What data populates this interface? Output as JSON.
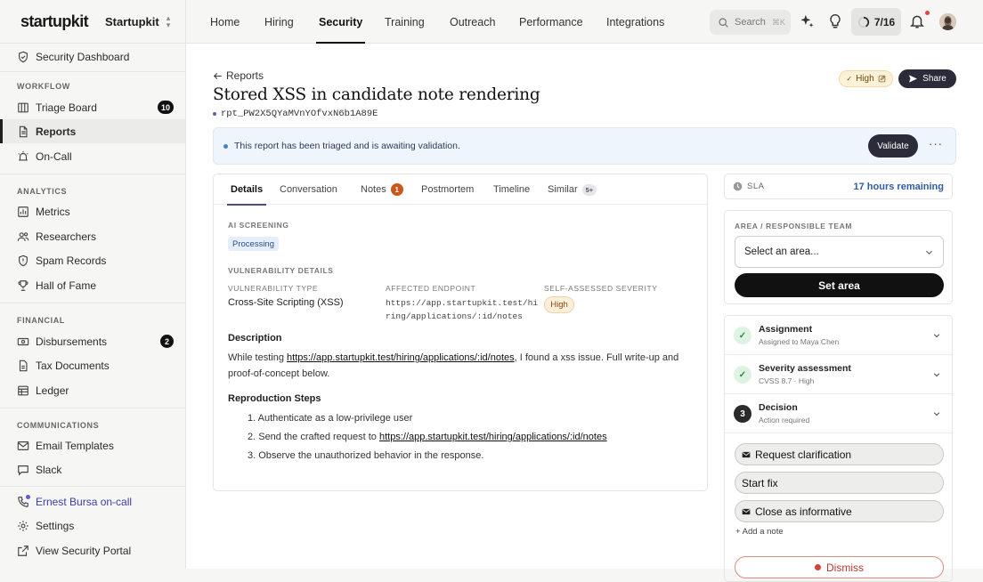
{
  "brand": {
    "logo": "startupkit",
    "org": "Startupkit"
  },
  "sidebar": {
    "top_item": "Security Dashboard",
    "sections": {
      "workflow": "WORKFLOW",
      "analytics": "ANALYTICS",
      "financial": "FINANCIAL",
      "communications": "COMMUNICATIONS"
    },
    "items": {
      "triage": {
        "label": "Triage Board",
        "badge": "10"
      },
      "reports": {
        "label": "Reports"
      },
      "oncall": {
        "label": "On-Call"
      },
      "metrics": {
        "label": "Metrics"
      },
      "researchers": {
        "label": "Researchers"
      },
      "spam": {
        "label": "Spam Records"
      },
      "hall": {
        "label": "Hall of Fame"
      },
      "disbursements": {
        "label": "Disbursements",
        "badge": "2"
      },
      "tax": {
        "label": "Tax Documents"
      },
      "ledger": {
        "label": "Ledger"
      },
      "email": {
        "label": "Email Templates"
      },
      "slack": {
        "label": "Slack"
      }
    },
    "footer": {
      "oncall_user": "Ernest Bursa on-call",
      "settings": "Settings",
      "portal": "View Security Portal"
    }
  },
  "topnav": {
    "tabs": [
      "Home",
      "Hiring",
      "Security",
      "Training",
      "Outreach",
      "Performance",
      "Integrations"
    ],
    "active_tab": "Security",
    "search_placeholder": "Search",
    "search_shortcut": "⌘K",
    "progress": "7/16"
  },
  "report": {
    "back_label": "Reports",
    "title": "Stored XSS in candidate note rendering",
    "id": "rpt_PW2X5QYaMVnYOfvxN6b1A89E",
    "severity_pill": "High",
    "share_label": "Share",
    "banner": "This report has been triaged and is awaiting validation.",
    "validate_label": "Validate"
  },
  "detail_tabs": {
    "details": "Details",
    "conversation": "Conversation",
    "notes": "Notes",
    "notes_count": "1",
    "postmortem": "Postmortem",
    "timeline": "Timeline",
    "similar": "Similar",
    "similar_count": "5+"
  },
  "details": {
    "ai_label": "AI SCREENING",
    "ai_status": "Processing",
    "vuln_label": "VULNERABILITY DETAILS",
    "type_label": "VULNERABILITY TYPE",
    "type_value": "Cross-Site Scripting (XSS)",
    "endpoint_label": "AFFECTED ENDPOINT",
    "endpoint_line1": "https://app.startupkit.test/hi",
    "endpoint_line2": "ring/applications/:id/notes",
    "severity_label": "SELF-ASSESSED SEVERITY",
    "severity_value": "High",
    "desc_heading": "Description",
    "desc_pre": "While testing ",
    "desc_link": "https://app.startupkit.test/hiring/applications/:id/notes",
    "desc_post": ", I found a xss issue. Full write-up and proof-of-concept below.",
    "repro_heading": "Reproduction Steps",
    "step1": "1. Authenticate as a low-privilege user",
    "step2_pre": "2. Send the crafted request to ",
    "step2_link": "https://app.startupkit.test/hiring/applications/:id/notes",
    "step3": "3. Observe the unauthorized behavior in the response."
  },
  "rail": {
    "sla_label": "SLA",
    "sla_remaining": "17 hours remaining",
    "area_label": "AREA / RESPONSIBLE TEAM",
    "area_select": "Select an area...",
    "set_area": "Set area",
    "assignment_title": "Assignment",
    "assignment_sub": "Assigned to Maya Chen",
    "severity_title": "Severity assessment",
    "severity_sub": "CVSS 8.7 · High",
    "decision_num": "3",
    "decision_title": "Decision",
    "decision_sub": "Action required",
    "request_clarification": "Request clarification",
    "start_fix": "Start fix",
    "close_informative": "Close as informative",
    "add_note": "+ Add a note",
    "dismiss": "Dismiss"
  },
  "colors": {
    "accent": "#2b2b3a",
    "link_blue": "#2f5ca8",
    "badge_orange": "#c8581b",
    "danger": "#d0433a"
  }
}
